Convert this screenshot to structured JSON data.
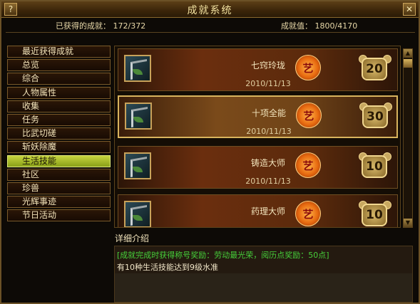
{
  "window": {
    "title": "成就系统",
    "help_label": "?",
    "close_label": "✕"
  },
  "stats": {
    "obtained": "已获得的成就： 172/372",
    "points": "成就值： 1800/4170"
  },
  "sidebar": {
    "items": [
      {
        "label": "最近获得成就"
      },
      {
        "label": "总览"
      },
      {
        "label": "综合"
      },
      {
        "label": "人物属性"
      },
      {
        "label": "收集"
      },
      {
        "label": "任务"
      },
      {
        "label": "比武切磋"
      },
      {
        "label": "斩妖除魔"
      },
      {
        "label": "生活技能"
      },
      {
        "label": "社区"
      },
      {
        "label": "珍兽"
      },
      {
        "label": "光辉事迹"
      },
      {
        "label": "节日活动"
      }
    ],
    "active_index": 8
  },
  "achievements": [
    {
      "name": "七窍玲珑",
      "date": "2010/11/13",
      "points": "20",
      "seal": "艺",
      "icon": "sword-achievement-icon"
    },
    {
      "name": "十项全能",
      "date": "2010/11/13",
      "points": "30",
      "seal": "艺",
      "icon": "sword-achievement-icon"
    },
    {
      "name": "铸造大师",
      "date": "2010/11/13",
      "points": "10",
      "seal": "艺",
      "icon": "sword-achievement-icon"
    },
    {
      "name": "药理大师",
      "date": "",
      "points": "10",
      "seal": "艺",
      "icon": "sword-achievement-icon"
    }
  ],
  "scrollbar": {
    "up": "▲",
    "down": "▼"
  },
  "detail": {
    "label": "详细介绍",
    "reward": "[成就完成时获得称号奖励：劳动最光荣，阅历点奖励：50点]",
    "description": "有10种生活技能达到9级水准"
  },
  "colors": {
    "active_tab": "#a9bd2a",
    "reward_text": "#46d03a",
    "frame": "#6b5126"
  }
}
